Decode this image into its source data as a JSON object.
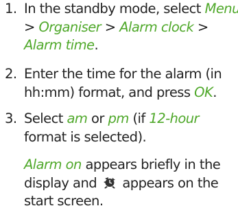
{
  "steps": [
    {
      "number": "1.",
      "line1_a": "In the standby mode, select ",
      "line1_b": "Menu",
      "line2_a": "> ",
      "line2_b": "Organiser",
      "line2_c": " > ",
      "line2_d": "Alarm clock",
      "line2_e": " >",
      "line3_a": "Alarm time",
      "line3_b": "."
    },
    {
      "number": "2.",
      "line1_a": "Enter the time for the alarm (in",
      "line2_a": "hh:mm) format, and press ",
      "line2_b": "OK",
      "line2_c": "."
    },
    {
      "number": "3.",
      "line1_a": "Select ",
      "line1_b": "am",
      "line1_c": " or ",
      "line1_d": "pm",
      "line1_e": " (if ",
      "line1_f": "12-hour",
      "line2_a": "format is selected)."
    }
  ],
  "note": {
    "line1_a": "Alarm on",
    "line1_b": " appears briefly in the",
    "line2_a": "display and ",
    "line2_icon": "alarm-clock-icon",
    "line2_b": " appears on the",
    "line3_a": "start screen."
  },
  "colors": {
    "text": "#222222",
    "highlight": "#4fa82a"
  }
}
